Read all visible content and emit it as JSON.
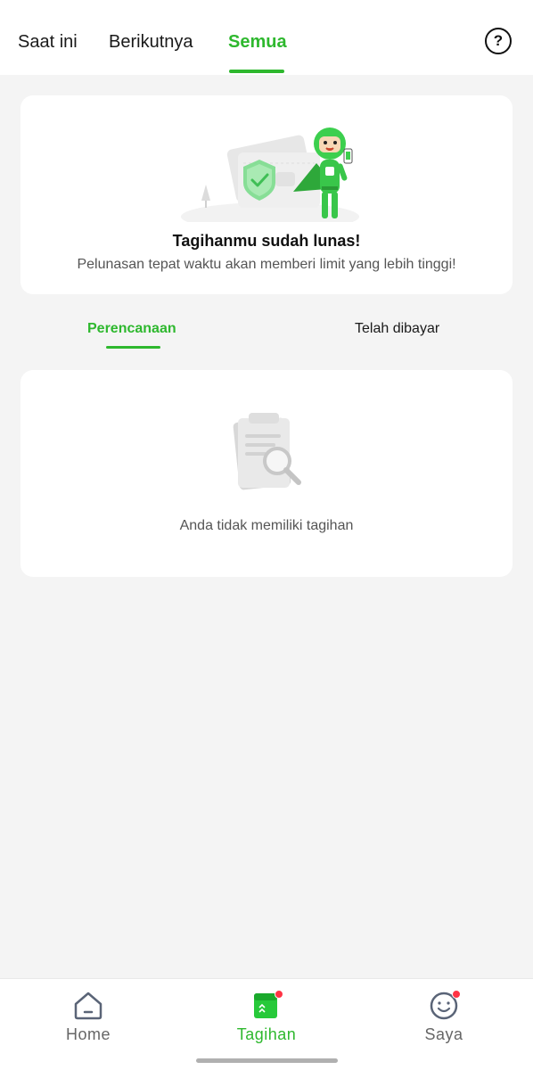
{
  "top_tabs": [
    {
      "label": "Saat ini"
    },
    {
      "label": "Berikutnya"
    },
    {
      "label": "Semua"
    }
  ],
  "paid_card": {
    "title": "Tagihanmu sudah lunas!",
    "subtitle": "Pelunasan tepat waktu akan memberi limit yang lebih tinggi!"
  },
  "sub_tabs": [
    {
      "label": "Perencanaan"
    },
    {
      "label": "Telah dibayar"
    }
  ],
  "empty_state": {
    "message": "Anda tidak memiliki tagihan"
  },
  "bottom_nav": [
    {
      "label": "Home",
      "icon": "home-icon"
    },
    {
      "label": "Tagihan",
      "icon": "bill-icon"
    },
    {
      "label": "Saya",
      "icon": "profile-smile-icon"
    }
  ],
  "colors": {
    "accent": "#2eb82e",
    "background": "#f4f4f4",
    "badge": "#ff3344"
  }
}
